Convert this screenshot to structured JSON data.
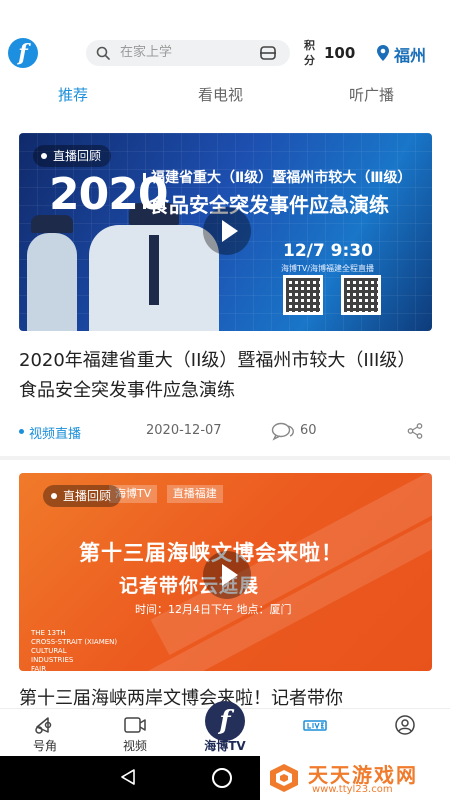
{
  "header": {
    "search_placeholder": "在家上学",
    "points_label": "积分",
    "points_value": "100",
    "city": "福州"
  },
  "tabs": [
    {
      "label": "推荐",
      "active": true
    },
    {
      "label": "看电视",
      "active": false
    },
    {
      "label": "听广播",
      "active": false
    }
  ],
  "cards": [
    {
      "badge": "直播回顾",
      "thumb": {
        "year": "2020",
        "line1": "福建省重大（Ⅱ级）暨福州市较大（Ⅲ级）",
        "line2": "食品安全突发事件应急演练",
        "datetime": "12/7    9:30",
        "live_note": "海博TV/海博福建全程直播"
      },
      "title": "2020年福建省重大（II级）暨福州市较大（III级）食品安全突发事件应急演练",
      "tag": "视频直播",
      "date": "2020-12-07",
      "comments": "60"
    },
    {
      "badge": "直播回顾",
      "thumb": {
        "logos": [
          "海博TV",
          "直播福建"
        ],
        "line1": "第十三届海峡文博会来啦！",
        "line2": "记者带你云逛展",
        "info": "时间：12月4日下午    地点：厦门",
        "en": "THE 13TH\nCROSS-STRAIT (XIAMEN)\nCULTURAL\nINDUSTRIES\nFAIR"
      },
      "title": "第十三届海峡两岸文博会来啦！记者带你"
    }
  ],
  "bottom_nav": [
    {
      "label": "号角",
      "icon": "horn-icon"
    },
    {
      "label": "视频",
      "icon": "video-icon"
    },
    {
      "label": "海博TV",
      "icon": "haibo-logo"
    },
    {
      "label": "",
      "icon": "live-broadcast-icon"
    },
    {
      "label": "",
      "icon": "profile-icon"
    }
  ],
  "watermark": {
    "text": "天天游戏网",
    "url": "www.ttyl23.com"
  },
  "colors": {
    "accent": "#1b8fd9",
    "city": "#1a6fb8",
    "watermark": "#f07b2c"
  }
}
